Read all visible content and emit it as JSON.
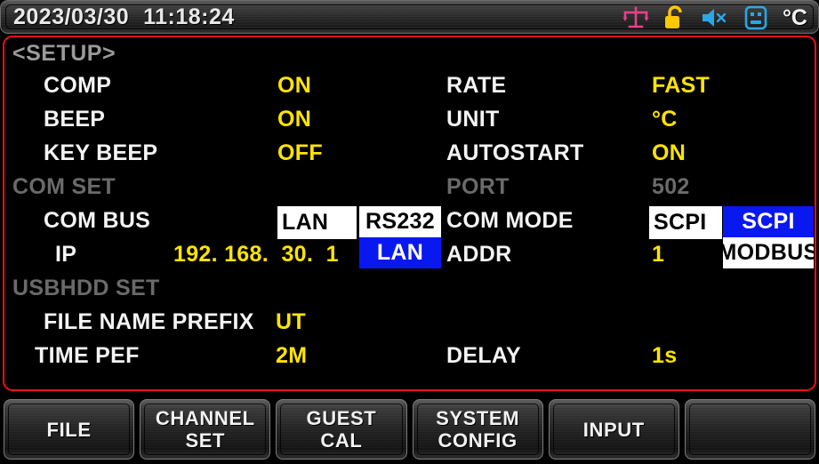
{
  "titlebar": {
    "date": "2023/03/30",
    "time": "11:18:24",
    "icons": [
      {
        "name": "balance-scale-icon",
        "color": "#e8408a"
      },
      {
        "name": "unlock-icon",
        "color": "#ffc800"
      },
      {
        "name": "speaker-mute-icon",
        "color": "#29a7e8"
      },
      {
        "name": "usb-device-icon",
        "color": "#29a7e8"
      }
    ],
    "unit_indicator": "°C"
  },
  "panel": {
    "title": "<SETUP>",
    "border_color": "#ee1111",
    "left_column": [
      {
        "label": "COMP",
        "value": "ON",
        "label_state": "white",
        "value_state": "yellow"
      },
      {
        "label": "BEEP",
        "value": "ON",
        "label_state": "white",
        "value_state": "yellow"
      },
      {
        "label": "KEY BEEP",
        "value": "OFF",
        "label_state": "white",
        "value_state": "yellow"
      },
      {
        "label": "COM SET",
        "value": "",
        "label_state": "dim",
        "value_state": "dim"
      },
      {
        "label": "COM BUS",
        "value": "LAN",
        "label_state": "white",
        "value_state": "editbox"
      },
      {
        "label": "IP",
        "value": "192. 168.  30.  1",
        "label_state": "white",
        "value_state": "yellow"
      },
      {
        "label": "USBHDD SET",
        "value": "",
        "label_state": "dim",
        "value_state": "dim"
      },
      {
        "label": "FILE NAME PREFIX",
        "value": "UT",
        "label_state": "white",
        "value_state": "yellow"
      },
      {
        "label": "TIME PEF",
        "value": "2M",
        "label_state": "white",
        "value_state": "yellow"
      }
    ],
    "right_column": [
      {
        "label": "RATE",
        "value": "FAST",
        "label_state": "white",
        "value_state": "yellow"
      },
      {
        "label": "UNIT",
        "value": "°C",
        "label_state": "white",
        "value_state": "yellow"
      },
      {
        "label": "AUTOSTART",
        "value": "ON",
        "label_state": "white",
        "value_state": "yellow"
      },
      {
        "label": "PORT",
        "value": "502",
        "label_state": "dim",
        "value_state": "dim"
      },
      {
        "label": "COM MODE",
        "value": "SCPI",
        "label_state": "white",
        "value_state": "editbox"
      },
      {
        "label": "ADDR",
        "value": "1",
        "label_state": "white",
        "value_state": "yellow"
      },
      {
        "label": "DELAY",
        "value": "1s",
        "label_state": "white",
        "value_state": "yellow"
      }
    ],
    "combus_dropdown": {
      "name": "com-bus-dropdown",
      "options": [
        "RS232",
        "LAN"
      ],
      "selected": "LAN",
      "selected_bg": "#0a18f0"
    },
    "commode_dropdown": {
      "name": "com-mode-dropdown",
      "options": [
        "SCPI",
        "MODBUS"
      ],
      "selected": "SCPI",
      "selected_bg": "#0a18f0"
    }
  },
  "softkeys": [
    {
      "label": "FILE"
    },
    {
      "label": "CHANNEL\nSET"
    },
    {
      "label": "GUEST\nCAL"
    },
    {
      "label": "SYSTEM\nCONFIG"
    },
    {
      "label": "INPUT"
    },
    {
      "label": ""
    }
  ]
}
